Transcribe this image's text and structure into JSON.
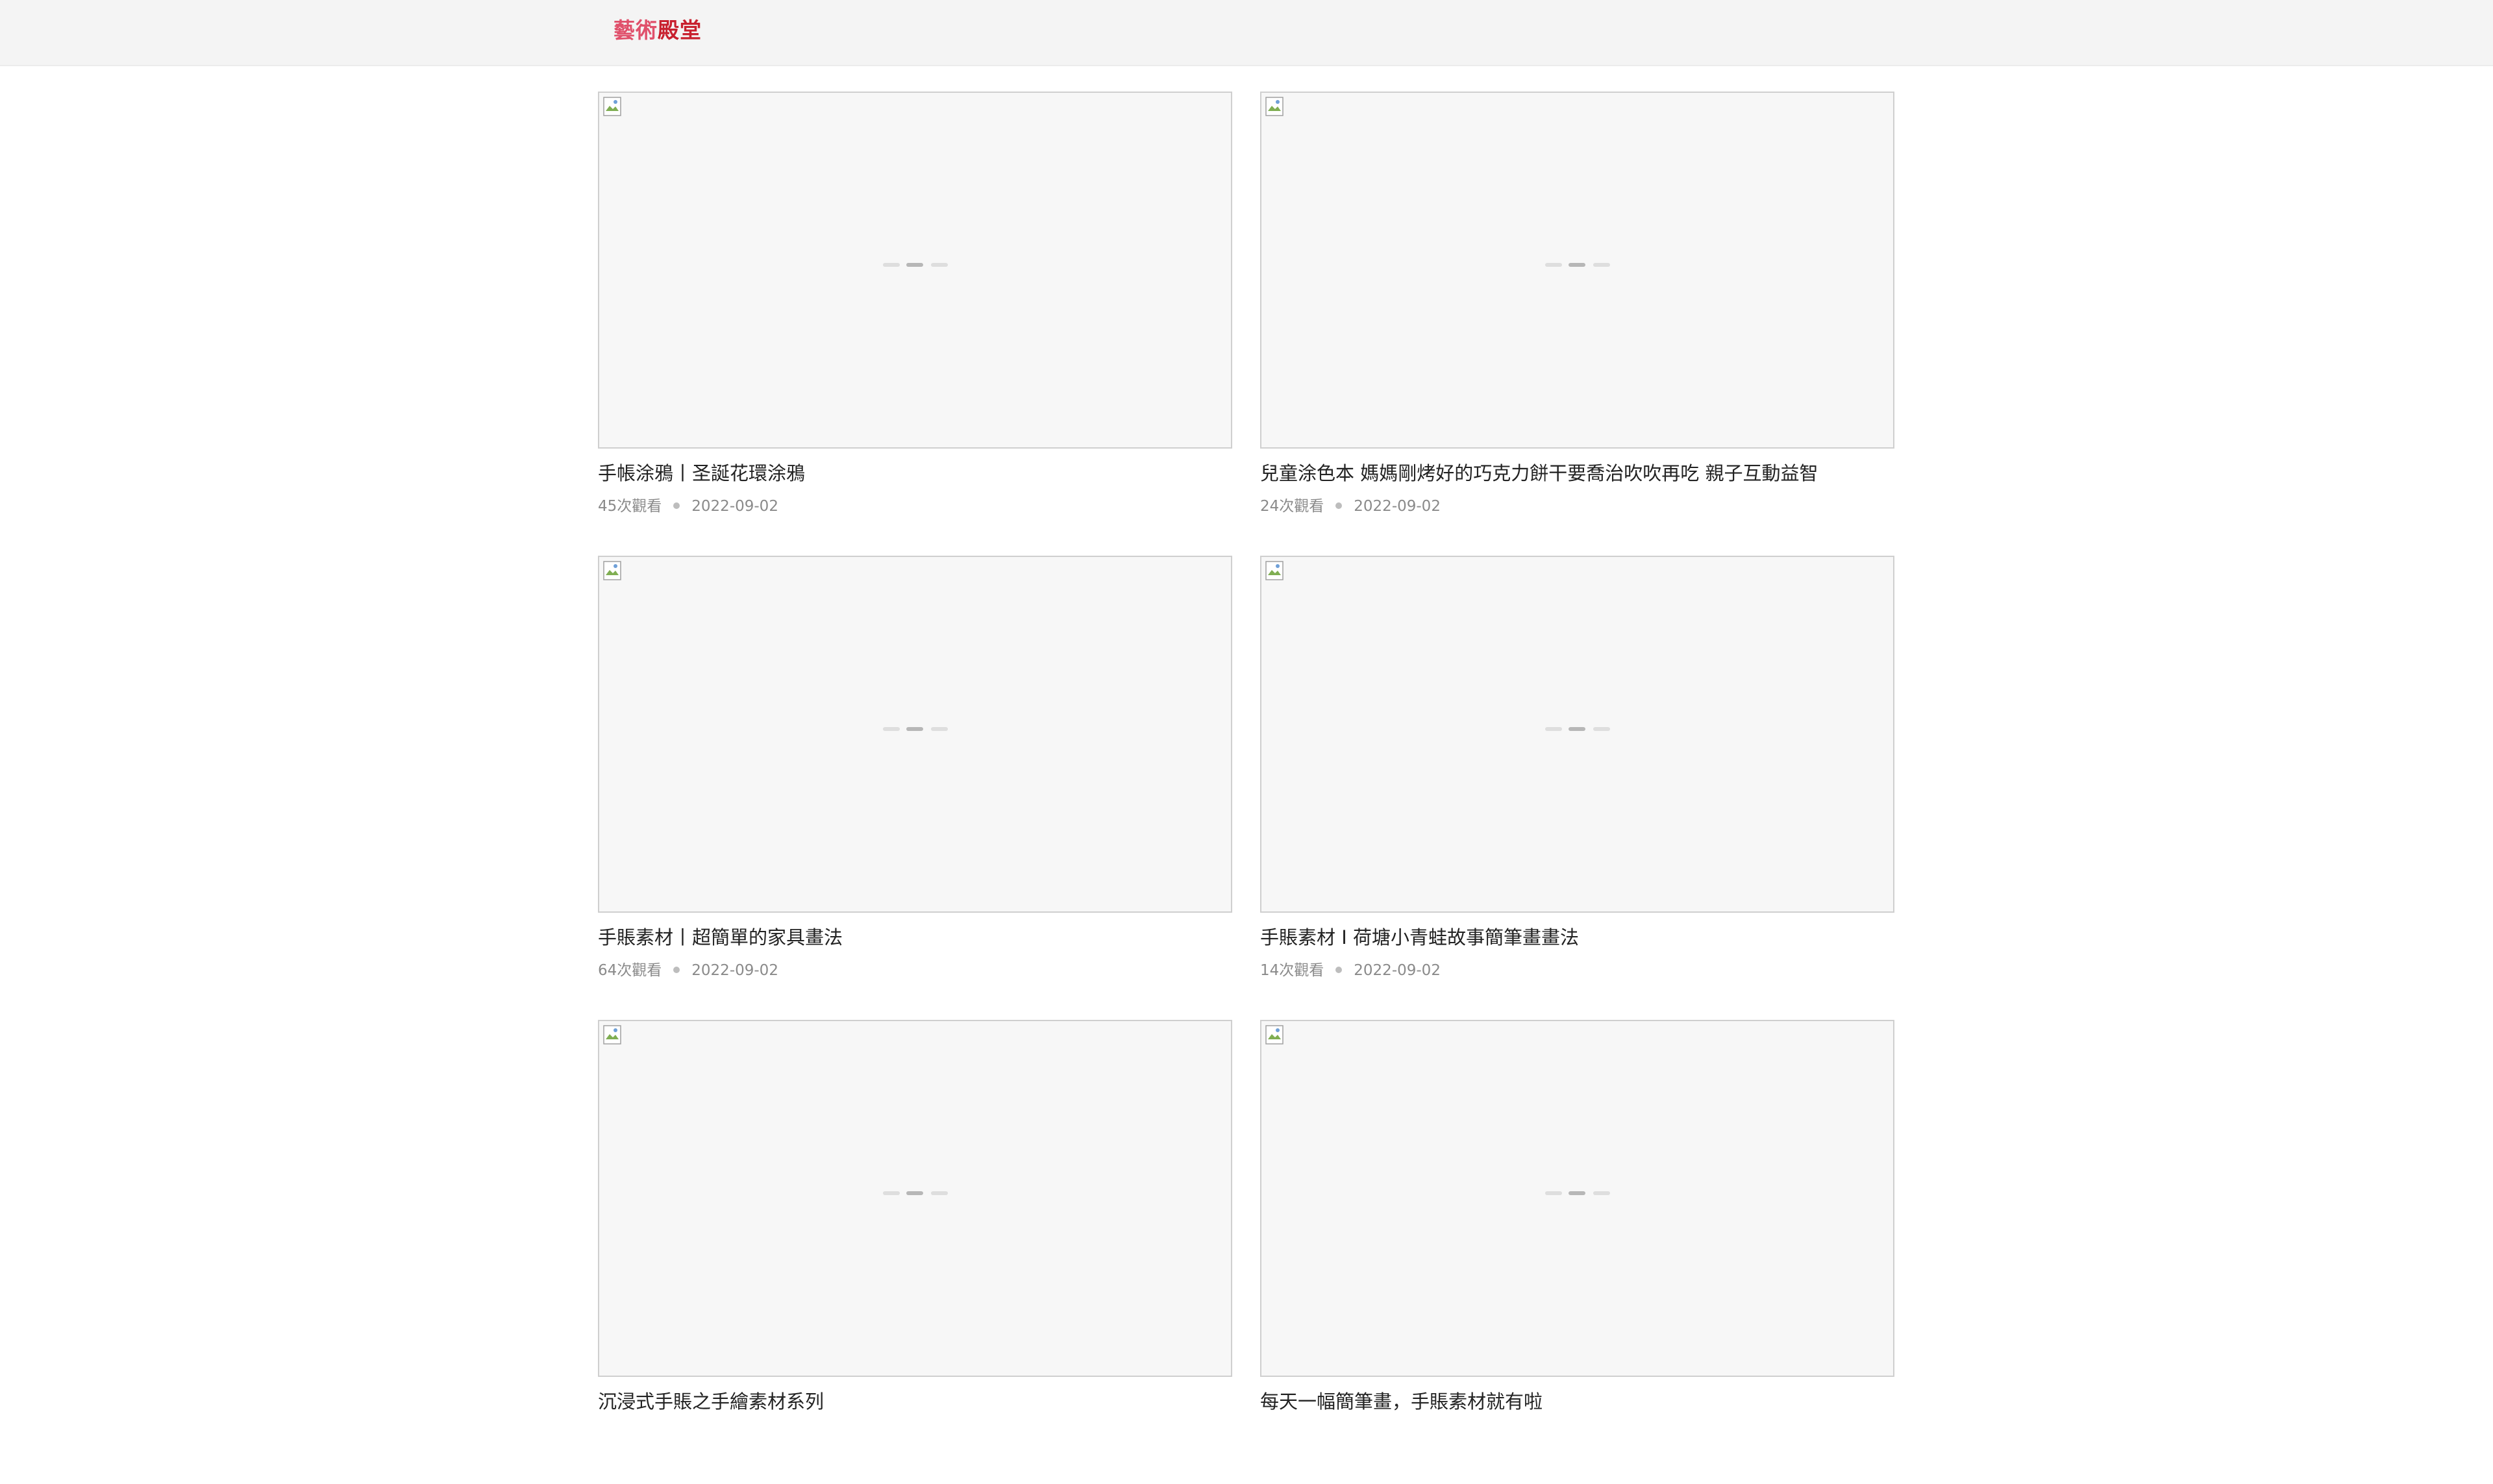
{
  "header": {
    "logo_part_a": "藝術",
    "logo_part_b": "殿堂",
    "colors": {
      "logo_a": "#e0506b",
      "logo_b": "#c8202e",
      "bar": "#f4f4f4"
    }
  },
  "videos": [
    {
      "title": "手帳涂鴉丨圣誕花環涂鴉",
      "views": "45次觀看",
      "date": "2022-09-02"
    },
    {
      "title": "兒童涂色本 媽媽剛烤好的巧克力餅干要喬治吹吹再吃 親子互動益智",
      "views": "24次觀看",
      "date": "2022-09-02"
    },
    {
      "title": "手賬素材丨超簡單的家具畫法",
      "views": "64次觀看",
      "date": "2022-09-02"
    },
    {
      "title": "手賬素材 I 荷塘小青蛙故事簡筆畫畫法",
      "views": "14次觀看",
      "date": "2022-09-02"
    },
    {
      "title": "沉浸式手賬之手繪素材系列",
      "views": "",
      "date": ""
    },
    {
      "title": "每天一幅簡筆畫，手賬素材就有啦",
      "views": "",
      "date": ""
    }
  ]
}
